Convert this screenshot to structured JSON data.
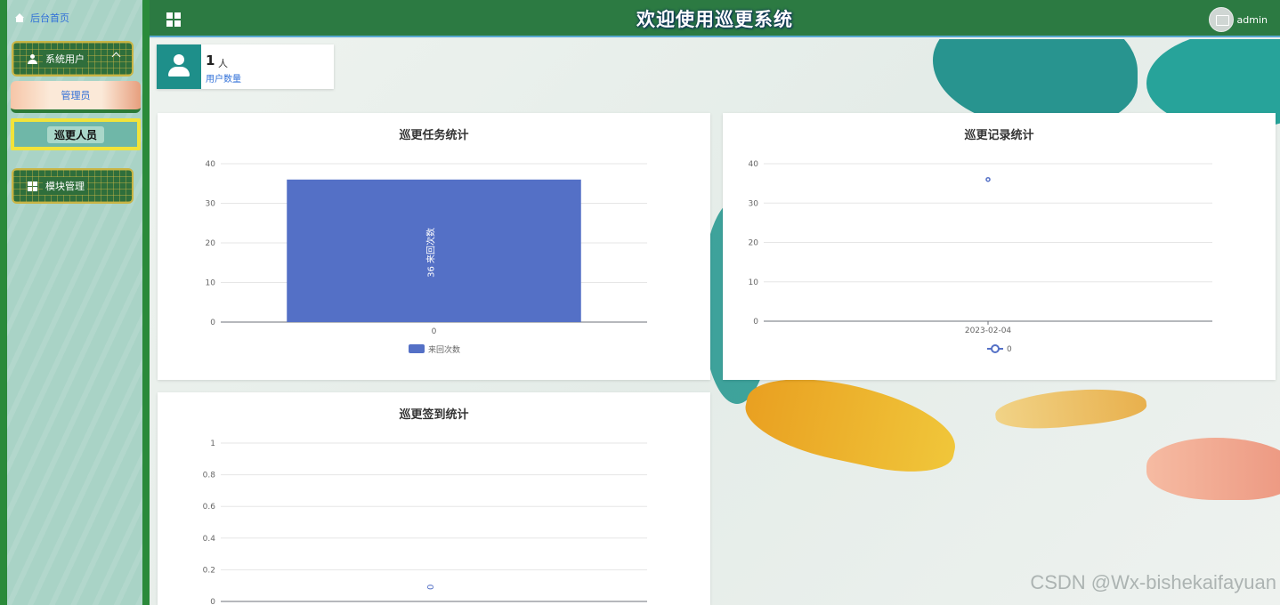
{
  "sidebar": {
    "home_label": "后台首页",
    "groups": [
      {
        "label": "系统用户",
        "icon": "person-icon"
      },
      {
        "label": "模块管理",
        "icon": "grid-icon"
      }
    ],
    "sub_items": [
      "管理员",
      "巡更人员"
    ]
  },
  "header": {
    "title": "欢迎使用巡更系统",
    "username": "admin"
  },
  "stat": {
    "value": "1",
    "unit": "人",
    "label": "用户数量"
  },
  "watermark": "CSDN @Wx-bishekaifayuan",
  "chart_data": [
    {
      "type": "bar",
      "title": "巡更任务统计",
      "categories": [
        "0"
      ],
      "series": [
        {
          "name": "来回次数",
          "values": [
            36
          ],
          "color": "#5470c6"
        }
      ],
      "ylim": [
        0,
        40
      ],
      "yticks": [
        0,
        10,
        20,
        30,
        40
      ],
      "data_label": "36 来回次数",
      "legend": "bottom",
      "grid": true
    },
    {
      "type": "line",
      "title": "巡更记录统计",
      "categories": [
        "2023-02-04"
      ],
      "series": [
        {
          "name": "0",
          "values": [
            36
          ],
          "color": "#5470c6"
        }
      ],
      "ylim": [
        0,
        40
      ],
      "yticks": [
        0,
        10,
        20,
        30,
        40
      ],
      "legend": "bottom",
      "grid": true
    },
    {
      "type": "bar",
      "title": "巡更签到统计",
      "categories": [],
      "series": [
        {
          "name": "",
          "values": [
            0
          ],
          "color": "#5470c6"
        }
      ],
      "ylim": [
        0,
        1
      ],
      "yticks": [
        0,
        0.2,
        0.4,
        0.6,
        0.8,
        1
      ],
      "data_label": "0",
      "grid": true
    }
  ]
}
